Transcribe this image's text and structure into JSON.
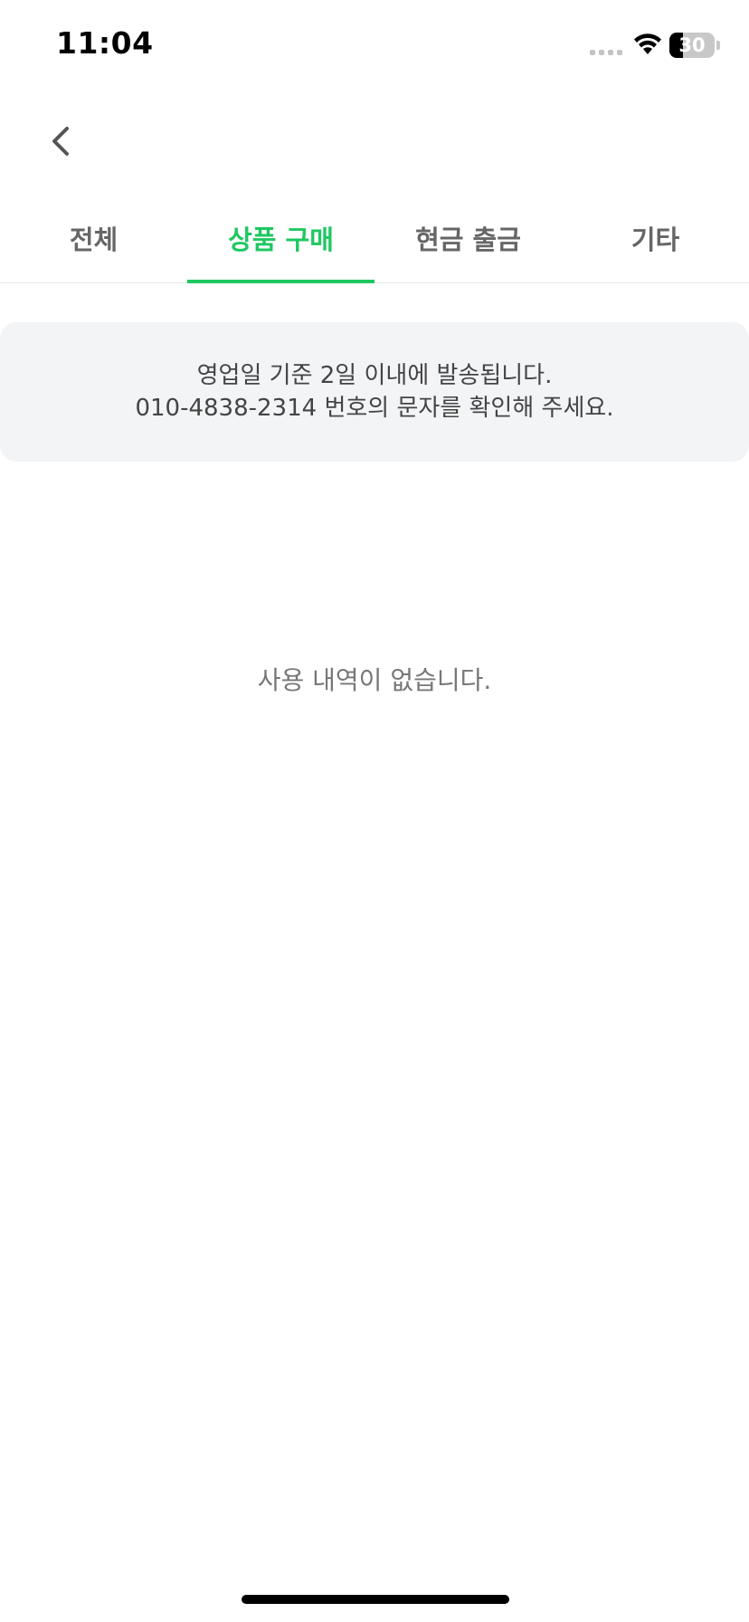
{
  "status_bar": {
    "time": "11:04",
    "battery_level": "30",
    "battery_fraction": 0.3,
    "icons": [
      "signal-icon",
      "wifi-icon",
      "battery-icon"
    ]
  },
  "header": {
    "back_icon": "chevron-left-icon"
  },
  "tabs": [
    {
      "label": "전체",
      "active": false
    },
    {
      "label": "상품 구매",
      "active": true
    },
    {
      "label": "현금 출금",
      "active": false
    },
    {
      "label": "기타",
      "active": false
    }
  ],
  "notice": {
    "line1": "영업일 기준 2일 이내에 발송됩니다.",
    "line2": "010-4838-2314 번호의 문자를 확인해 주세요."
  },
  "empty_state": {
    "message": "사용 내역이 없습니다."
  },
  "colors": {
    "accent": "#1ec861",
    "notice_bg": "#f3f4f6",
    "tab_inactive": "#666666"
  }
}
